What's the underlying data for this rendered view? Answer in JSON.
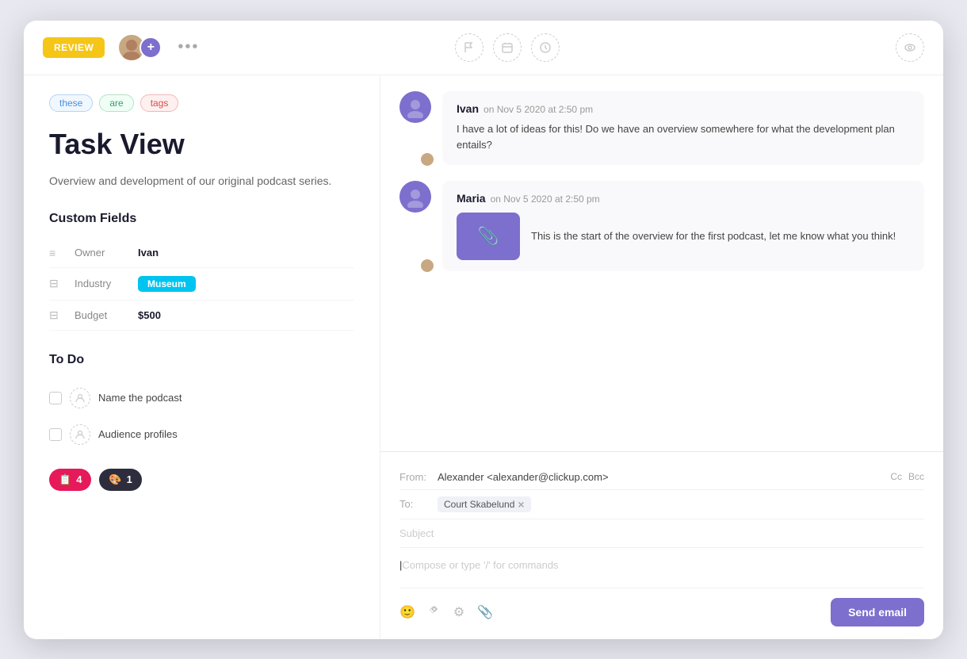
{
  "window": {
    "review_label": "REVIEW",
    "more_dots": "•••"
  },
  "toolbar": {
    "flag_icon": "flag",
    "calendar_icon": "calendar",
    "clock_icon": "clock",
    "eye_icon": "eye"
  },
  "task": {
    "tags": [
      {
        "id": "these",
        "label": "these",
        "style": "these"
      },
      {
        "id": "are",
        "label": "are",
        "style": "are"
      },
      {
        "id": "tags",
        "label": "tags",
        "style": "tags"
      }
    ],
    "title": "Task View",
    "description": "Overview and development of our original podcast series.",
    "custom_fields_title": "Custom Fields",
    "fields": [
      {
        "icon": "≡",
        "label": "Owner",
        "value": "Ivan",
        "type": "text"
      },
      {
        "icon": "⊟",
        "label": "Industry",
        "value": "Museum",
        "type": "badge"
      },
      {
        "icon": "⊟",
        "label": "Budget",
        "value": "$500",
        "type": "text"
      }
    ],
    "todo_title": "To Do",
    "todos": [
      {
        "text": "Name the podcast"
      },
      {
        "text": "Audience profiles"
      }
    ]
  },
  "bottom_bar": {
    "badge1_icon": "📋",
    "badge1_count": "4",
    "badge2_icon": "🎨",
    "badge2_count": "1"
  },
  "comments": [
    {
      "author": "Ivan",
      "timestamp": "on Nov 5 2020 at 2:50 pm",
      "text": "I have a lot of ideas for this! Do we have an overview somewhere for what the development plan entails?",
      "has_attachment": false
    },
    {
      "author": "Maria",
      "timestamp": "on Nov 5 2020 at 2:50 pm",
      "text": "This is the start of the overview for the first podcast, let me know what you think!",
      "has_attachment": true,
      "attachment_icon": "📎"
    }
  ],
  "email": {
    "from_label": "From:",
    "from_value": "Alexander <alexander@clickup.com>",
    "cc_label": "Cc",
    "bcc_label": "Bcc",
    "to_label": "To:",
    "to_value": "Court Skabelund",
    "subject_placeholder": "Subject",
    "compose_placeholder": "Compose or type '/' for commands",
    "send_button": "Send email"
  }
}
